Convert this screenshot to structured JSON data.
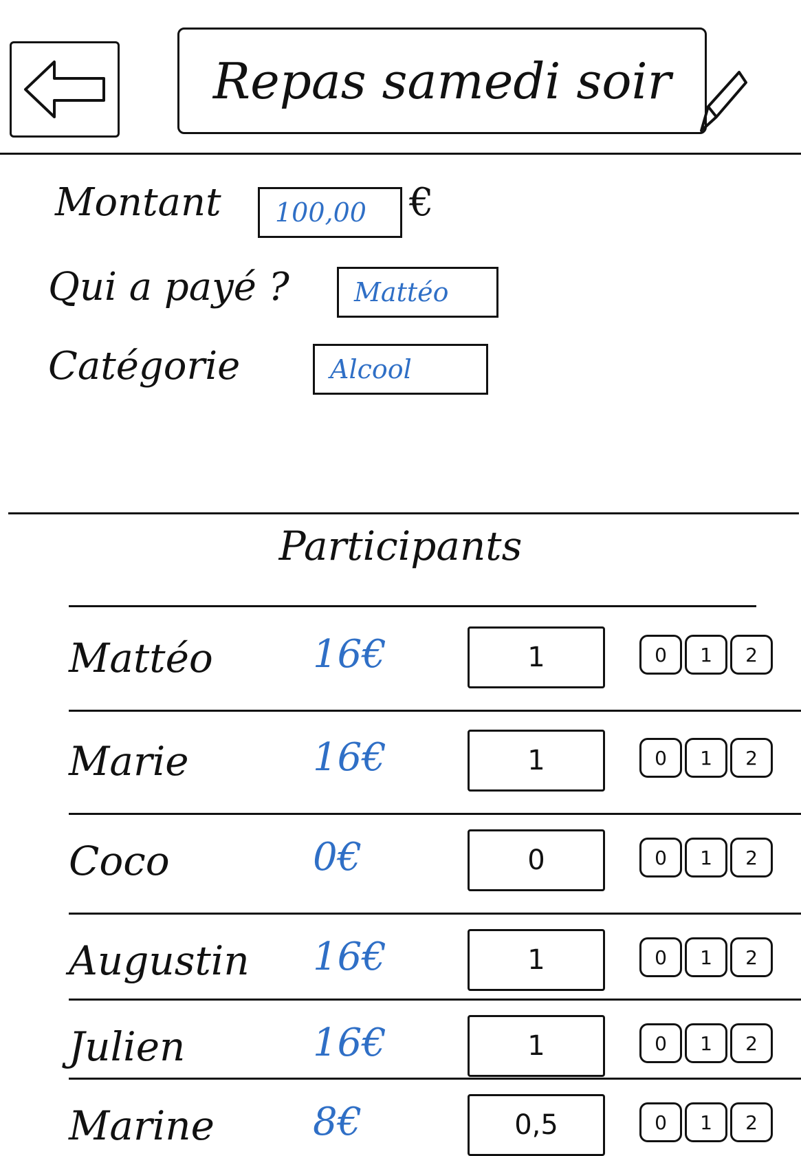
{
  "header": {
    "title": "Repas samedi soir",
    "back_icon": "arrow-left-icon",
    "edit_icon": "pencil-icon"
  },
  "form": {
    "amount_label": "Montant",
    "amount_value": "100,00",
    "currency": "€",
    "payer_label": "Qui a payé ?",
    "payer_value": "Mattéo",
    "category_label": "Catégorie",
    "category_value": "Alcool"
  },
  "participants_title": "Participants",
  "participants": [
    {
      "name": "Mattéo",
      "amount": "16€",
      "share": "1"
    },
    {
      "name": "Marie",
      "amount": "16€",
      "share": "1"
    },
    {
      "name": "Coco",
      "amount": "0€",
      "share": "0"
    },
    {
      "name": "Augustin",
      "amount": "16€",
      "share": "1"
    },
    {
      "name": "Julien",
      "amount": "16€",
      "share": "1"
    },
    {
      "name": "Marine",
      "amount": "8€",
      "share": "0,5"
    }
  ],
  "quick_shares": [
    "0",
    "1",
    "2"
  ],
  "colors": {
    "ink": "#111111",
    "accent": "#2f6fc6"
  }
}
